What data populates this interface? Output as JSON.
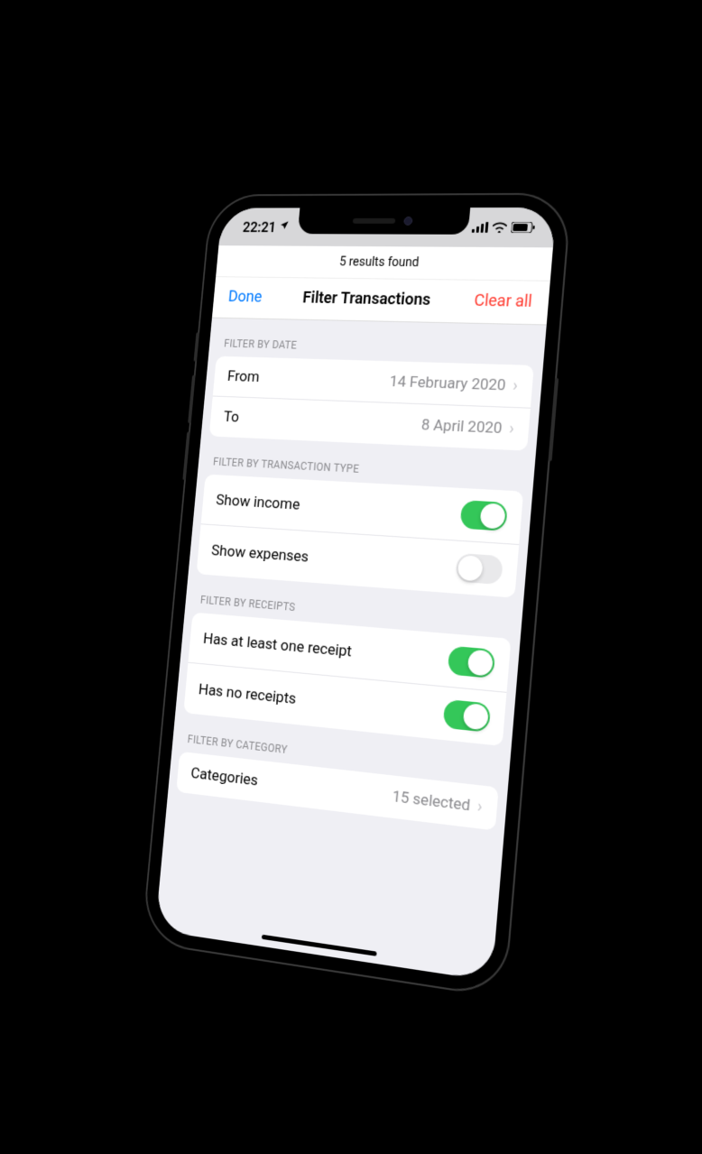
{
  "status_bar": {
    "time": "22:21",
    "location_icon": "location-arrow"
  },
  "results_bar": {
    "text": "5 results found"
  },
  "nav": {
    "done": "Done",
    "title": "Filter Transactions",
    "clear": "Clear all"
  },
  "sections": {
    "date": {
      "header": "FILTER BY DATE",
      "from_label": "From",
      "from_value": "14 February 2020",
      "to_label": "To",
      "to_value": "8 April 2020"
    },
    "type": {
      "header": "FILTER BY TRANSACTION TYPE",
      "income_label": "Show income",
      "income_on": true,
      "expenses_label": "Show expenses",
      "expenses_on": false
    },
    "receipts": {
      "header": "FILTER BY RECEIPTS",
      "has_label": "Has at least one receipt",
      "has_on": true,
      "none_label": "Has no receipts",
      "none_on": true
    },
    "category": {
      "header": "FILTER BY CATEGORY",
      "label": "Categories",
      "value": "15 selected"
    }
  }
}
